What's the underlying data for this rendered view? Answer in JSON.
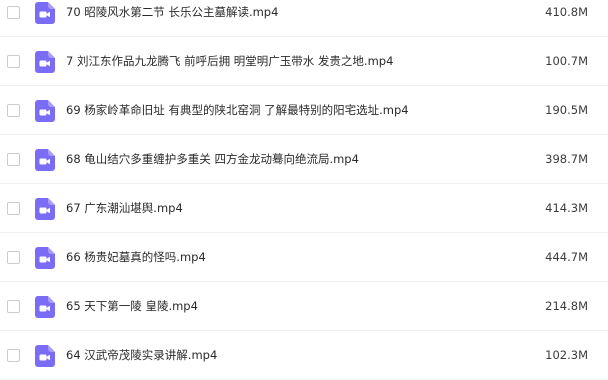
{
  "files": [
    {
      "name": "70 昭陵风水第二节 长乐公主墓解读.mp4",
      "size": "410.8M",
      "icon": "video-file-icon"
    },
    {
      "name": "7 刘江东作品九龙腾飞 前呼后拥 明堂明广玉带水 发贵之地.mp4",
      "size": "100.7M",
      "icon": "video-file-icon"
    },
    {
      "name": "69 杨家岭革命旧址 有典型的陕北窑洞 了解最特别的阳宅选址.mp4",
      "size": "190.5M",
      "icon": "video-file-icon"
    },
    {
      "name": "68 龟山结穴多重缠护多重关 四方金龙动蓦向绝流局.mp4",
      "size": "398.7M",
      "icon": "video-file-icon"
    },
    {
      "name": "67 广东潮汕堪舆.mp4",
      "size": "414.3M",
      "icon": "video-file-icon"
    },
    {
      "name": "66 杨贵妃墓真的怪吗.mp4",
      "size": "444.7M",
      "icon": "video-file-icon"
    },
    {
      "name": "65 天下第一陵 皇陵.mp4",
      "size": "214.8M",
      "icon": "video-file-icon"
    },
    {
      "name": "64 汉武帝茂陵实录讲解.mp4",
      "size": "102.3M",
      "icon": "video-file-icon"
    }
  ],
  "colors": {
    "icon_accent": "#7b6cf6",
    "row_divider": "#eef0f4"
  }
}
